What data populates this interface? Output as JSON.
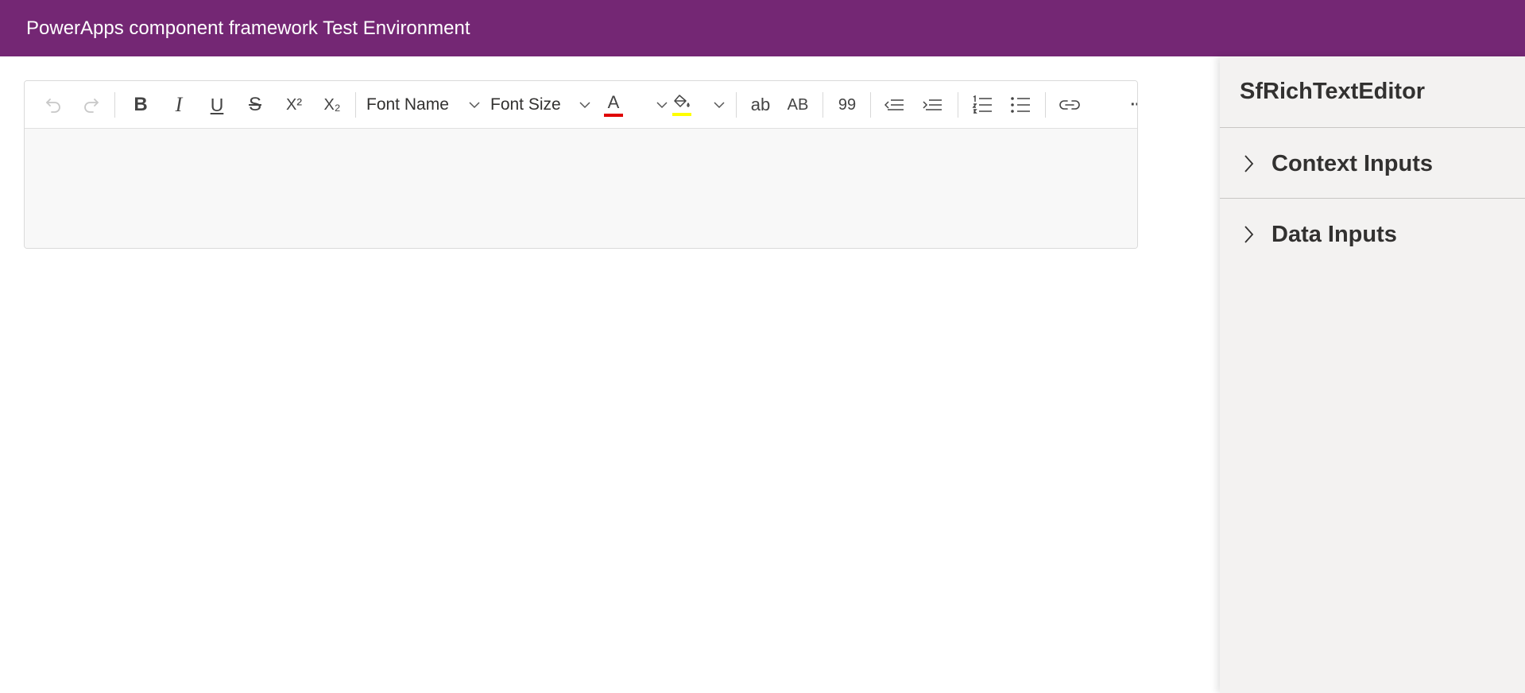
{
  "header": {
    "title": "PowerApps component framework Test Environment",
    "background": "#742774"
  },
  "toolbar": {
    "undo_icon": "undo-icon",
    "redo_icon": "redo-icon",
    "bold_glyph": "B",
    "italic_glyph": "I",
    "underline_glyph": "U",
    "strike_glyph": "S",
    "superscript_glyph": "X²",
    "subscript_glyph": "X₂",
    "font_name_label": "Font Name",
    "font_size_label": "Font Size",
    "font_color_glyph": "A",
    "font_color": "#e00000",
    "background_color": "#ffff00",
    "lowercase_glyph": "ab",
    "uppercase_glyph": "AB",
    "blockquote_glyph": "99",
    "more_glyph": "···"
  },
  "panel": {
    "title": "SfRichTextEditor",
    "sections": [
      {
        "label": "Context Inputs",
        "expanded": false
      },
      {
        "label": "Data Inputs",
        "expanded": false
      }
    ]
  }
}
